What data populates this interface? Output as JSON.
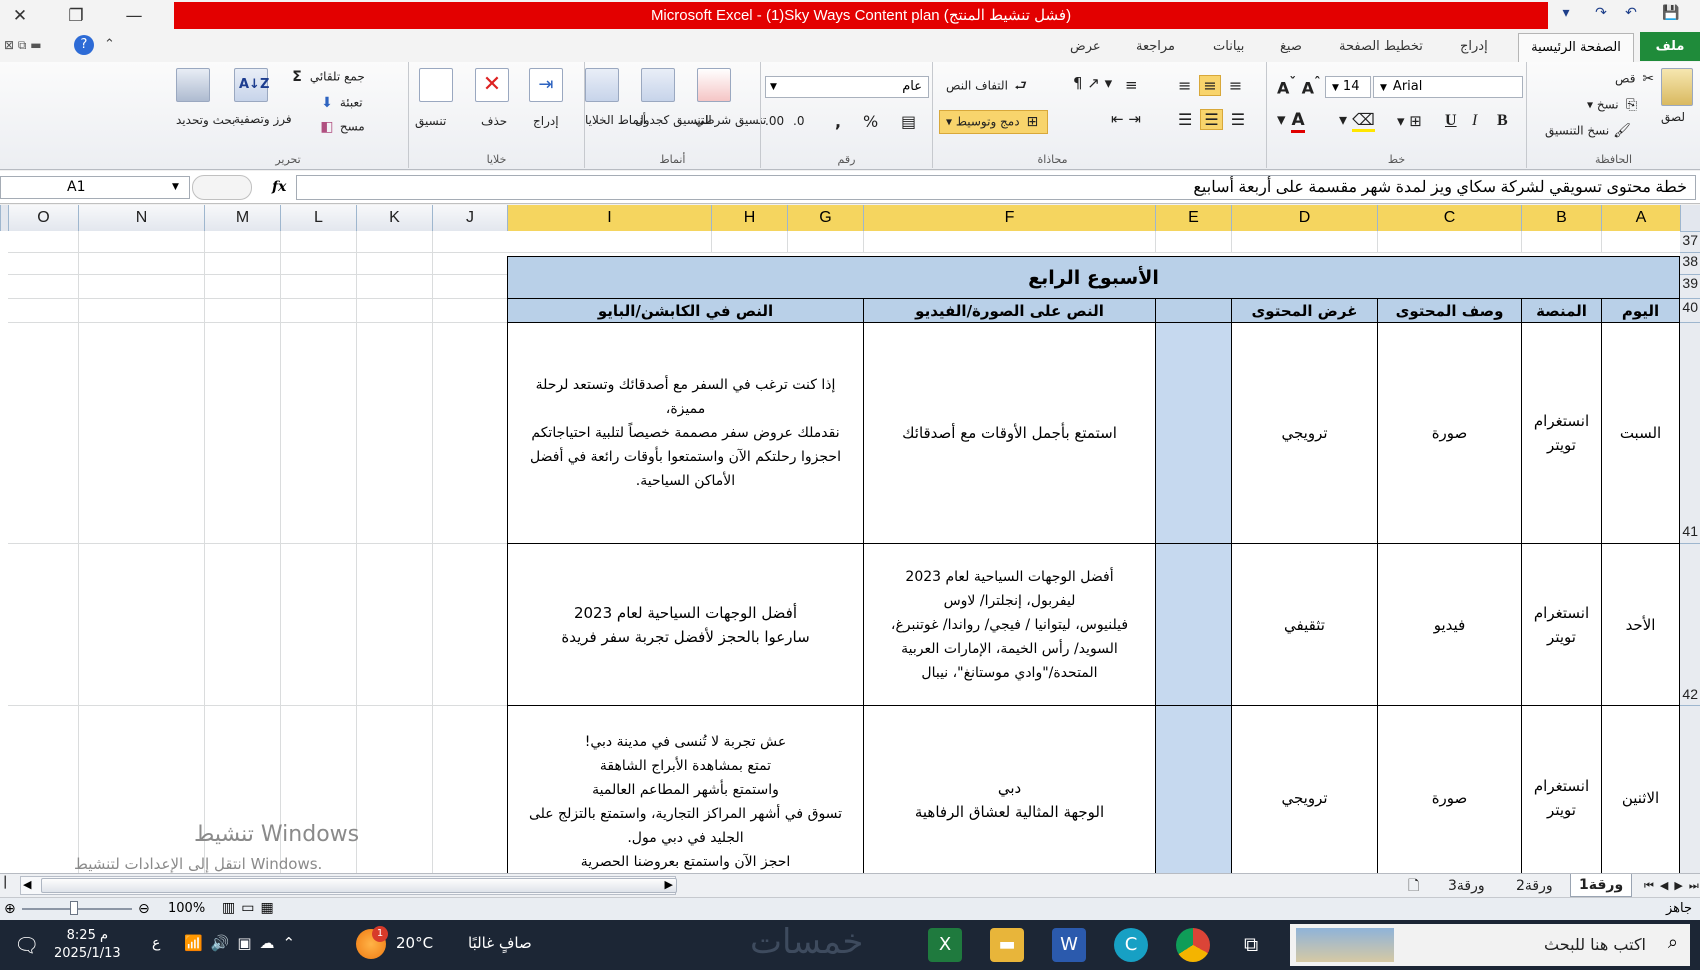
{
  "window": {
    "title": "Microsoft Excel - (1)Sky Ways Content plan (فشل تنشيط المنتج)"
  },
  "ribbon": {
    "tabs": [
      "ملف",
      "الصفحة الرئيسية",
      "إدراج",
      "تخطيط الصفحة",
      "صيغ",
      "بيانات",
      "مراجعة",
      "عرض"
    ],
    "clipboard": {
      "label": "الحافظة",
      "paste": "لصق",
      "cut": "قص",
      "copy": "نسخ",
      "format_painter": "نسخ التنسيق"
    },
    "font": {
      "label": "خط",
      "name": "Arial",
      "size": "14",
      "bold": "B",
      "italic": "I",
      "underline": "U"
    },
    "alignment": {
      "label": "محاذاة",
      "wrap": "التفاف النص",
      "merge": "دمج وتوسيط"
    },
    "number": {
      "label": "رقم",
      "format": "عام",
      "percent": "%",
      "comma": ","
    },
    "styles": {
      "label": "أنماط",
      "conditional": "تنسيق شرطي",
      "table": "التنسيق كجدول",
      "cell_styles": "أنماط الخلايا"
    },
    "cells": {
      "label": "خلايا",
      "insert": "إدراج",
      "delete": "حذف",
      "format": "تنسيق"
    },
    "editing": {
      "label": "تحرير",
      "autosum": "جمع تلقائي",
      "fill": "تعبئة",
      "clear": "مسح",
      "sort": "فرز وتصفية",
      "find": "بحث وتحديد"
    }
  },
  "formula_bar": {
    "name_box": "A1",
    "fx": "fx",
    "content": "خطة محتوى تسويقي لشركة سكاي ويز لمدة شهر مقسمة على أربعة أسابيع"
  },
  "columns": [
    "A",
    "B",
    "C",
    "D",
    "E",
    "F",
    "G",
    "H",
    "I",
    "J",
    "K",
    "L",
    "M",
    "N",
    "O"
  ],
  "rows": [
    "37",
    "38",
    "39",
    "40",
    "41",
    "42"
  ],
  "sheet": {
    "week_title": "الأسبوع الرابع",
    "headers": {
      "day": "اليوم",
      "platform": "المنصة",
      "desc": "وصف المحتوى",
      "purpose": "غرض المحتوى",
      "image_text": "النص على الصورة/الفيديو",
      "caption": "النص في الكابشن/البايو"
    },
    "rows": [
      {
        "day": "السبت",
        "platform": "انستغرام\nتويتر",
        "desc": "صورة",
        "purpose": "ترويجي",
        "image_text": "استمتع بأجمل الأوقات مع أصدقائك",
        "caption": "إذا كنت ترغب في السفر مع أصدقائك وتستعد لرحلة مميزة،\nنقدملك عروض سفر مصممة خصيصاً لتلبية احتياجاتكم\nاحجزوا رحلتكم الآن واستمتعوا بأوقات رائعة في أفضل الأماكن السياحية."
      },
      {
        "day": "الأحد",
        "platform": "انستغرام\nتويتر",
        "desc": "فيديو",
        "purpose": "تثقيفي",
        "image_text": "أفضل الوجهات السياحية لعام 2023\nليفربول، إنجلترا/ لاوس\nفيلنيوس، ليتوانيا / فيجي/ رواندا/ غوتنبرغ، السويد/ رأس الخيمة، الإمارات العربية المتحدة/\"وادي موستانغ\"، نيبال",
        "caption": "أفضل الوجهات السياحية لعام 2023\nسارعوا بالحجز لأفضل تجربة سفر فريدة"
      },
      {
        "day": "الاثنين",
        "platform": "انستغرام\nتويتر",
        "desc": "صورة",
        "purpose": "ترويجي",
        "image_text": "دبي\nالوجهة المثالية لعشاق الرفاهية",
        "caption": "عش تجربة لا تُنسى في مدينة دبي!\nتمتع بمشاهدة الأبراج الشاهقة\nواستمتع بأشهر المطاعم العالمية\nتسوق في أشهر المراكز التجارية، واستمتع بالتزلج على الجليد في دبي مول.\nاحجز الآن واستمتع بعروضنا الحصرية"
      }
    ]
  },
  "sheet_tabs": [
    "ورقة1",
    "ورقة2",
    "ورقة3"
  ],
  "status": {
    "ready": "جاهز",
    "zoom": "100%"
  },
  "watermark": {
    "title": "تنشيط Windows",
    "sub": "انتقل إلى الإعدادات لتنشيط Windows."
  },
  "taskbar": {
    "search": "اكتب هنا للبحث",
    "time": "8:25 م",
    "date": "2025/1/13",
    "weather_temp": "20°C",
    "weather_desc": "صافٍ غالبًا",
    "lang": "ع",
    "notif_count": "1",
    "logo_text": "خمسات"
  }
}
